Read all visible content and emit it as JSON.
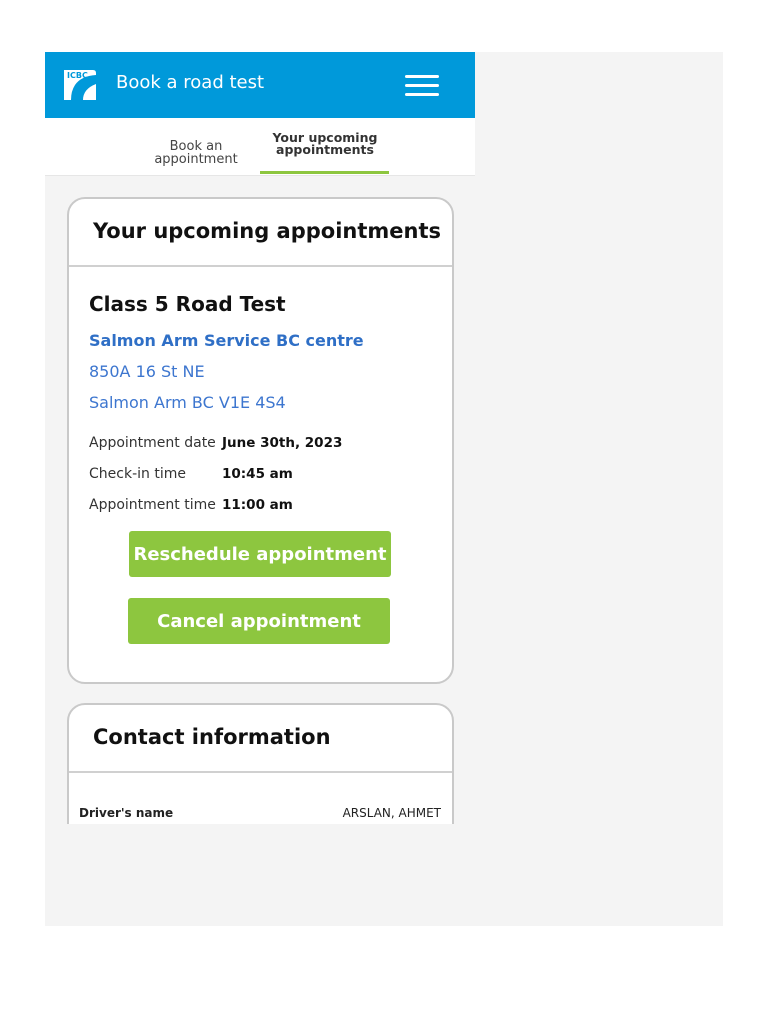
{
  "header": {
    "logo_text": "ICBC",
    "title": "Book a road test",
    "menu_icon": "hamburger-menu-icon"
  },
  "tabs": {
    "book": "Book an appointment",
    "upcoming": "Your upcoming appointments"
  },
  "appointments_card": {
    "title": "Your upcoming appointments",
    "test_type": "Class 5 Road Test",
    "location_name": "Salmon Arm Service BC centre",
    "address_line1": "850A 16 St NE",
    "address_line2": "Salmon Arm BC V1E 4S4",
    "details": {
      "date_label": "Appointment date",
      "date_value": "June 30th, 2023",
      "checkin_label": "Check-in time",
      "checkin_value": "10:45 am",
      "time_label": "Appointment time",
      "time_value": "11:00 am"
    },
    "reschedule_label": "Reschedule appointment",
    "cancel_label": "Cancel appointment"
  },
  "contact_card": {
    "title": "Contact information",
    "driver_name_label": "Driver's name",
    "driver_name_value": "ARSLAN, AHMET"
  },
  "colors": {
    "header_blue": "#0099da",
    "accent_green": "#8dc63f",
    "link_blue": "#2f6fc6"
  }
}
